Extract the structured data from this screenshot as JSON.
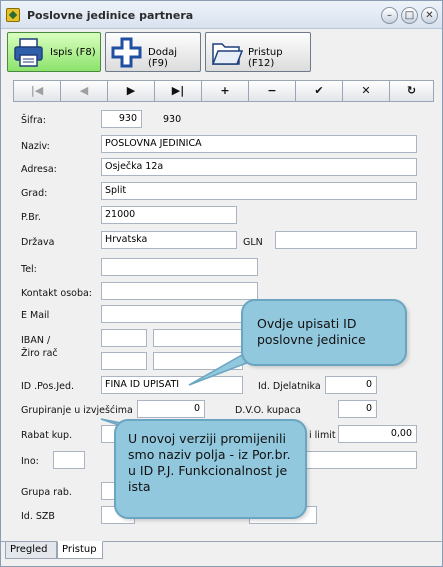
{
  "window": {
    "title": "Poslovne jedinice partnera"
  },
  "toolbar": {
    "print_label": "Ispis (F8)",
    "add_label": "Dodaj (F9)",
    "access_label": "Pristup (F12)"
  },
  "navbar": {
    "first": "|◀",
    "prev": "◀",
    "next": "▶",
    "last": "▶|",
    "insert": "+",
    "delete": "−",
    "post": "✔",
    "cancel": "✕",
    "refresh": "↻"
  },
  "form": {
    "sifra_label": "Šifra:",
    "sifra_value": "930",
    "sifra_display": "930",
    "naziv_label": "Naziv:",
    "naziv_value": "POSLOVNA JEDINICA",
    "adresa_label": "Adresa:",
    "adresa_value": "Osječka 12a",
    "grad_label": "Grad:",
    "grad_value": "Split",
    "pbr_label": "P.Br.",
    "pbr_value": "21000",
    "drzava_label": "Država",
    "drzava_value": "Hrvatska",
    "gln_label": "GLN",
    "gln_value": "",
    "tel_label": "Tel:",
    "tel_value": "",
    "kontakt_label": "Kontakt osoba:",
    "kontakt_value": "",
    "email_label": "E Mail",
    "email_value": "",
    "iban_label_1": "IBAN /",
    "iban_label_2": "Žiro rač",
    "id_posjed_label": "ID .Pos.Jed.",
    "id_posjed_value": "FINA ID UPISATI",
    "id_djelatnika_label": "Id. Djelatnika",
    "id_djelatnika_value": "0",
    "grupiranje_label": "Grupiranje u izvješćima",
    "grupiranje_value": "0",
    "dvo_label": "D.V.O. kupaca",
    "dvo_value": "0",
    "rabat_label": "Rabat kup.",
    "limit_label": "i limit",
    "limit_value": "0,00",
    "ino_label": "Ino:",
    "grupa_rab_label": "Grupa rab.",
    "id_szb_label": "Id. SZB"
  },
  "callouts": {
    "top": "Ovdje upisati ID poslovne jedinice",
    "bottom": "U novoj verziji promijenili smo naziv polja - iz Por.br. u ID P.J. Funkcionalnost je ista"
  },
  "tabs": [
    "Pregled",
    "Pristup"
  ],
  "colors": {
    "callout_fill": "#92c8dd",
    "active_button": "#8ce36c"
  },
  "icons": {
    "title": "app-icon",
    "print": "printer-icon",
    "add": "plus-icon",
    "access": "folder-icon"
  }
}
